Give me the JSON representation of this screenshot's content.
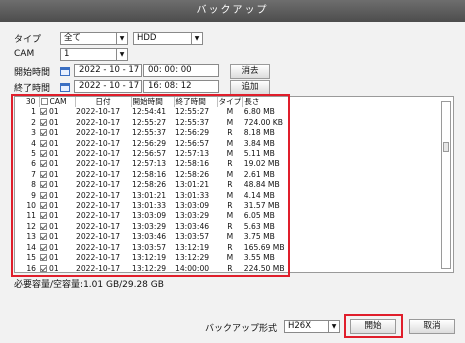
{
  "window": {
    "title": "バックアップ"
  },
  "filters": {
    "type_label": "タイプ",
    "type_value": "全て",
    "device_value": "HDD",
    "cam_label": "CAM",
    "cam_value": "1",
    "start_label": "開始時間",
    "start_date": "2022 - 10 - 17",
    "start_time": "00: 00: 00",
    "clear_button": "消去",
    "end_label": "終了時間",
    "end_date": "2022 - 10 - 17",
    "end_time": "16: 08: 12",
    "add_button": "追加"
  },
  "table": {
    "headers": {
      "count": "30",
      "cam": "CAM",
      "date": "日付",
      "start": "開始時間",
      "end": "終了時間",
      "type": "タイプ",
      "length": "長さ"
    },
    "rows": [
      {
        "no": "1",
        "cam": "01",
        "date": "2022-10-17",
        "start": "12:54:41",
        "end": "12:55:27",
        "type": "M",
        "length": "6.80 MB"
      },
      {
        "no": "2",
        "cam": "01",
        "date": "2022-10-17",
        "start": "12:55:27",
        "end": "12:55:37",
        "type": "M",
        "length": "724.00 KB"
      },
      {
        "no": "3",
        "cam": "01",
        "date": "2022-10-17",
        "start": "12:55:37",
        "end": "12:56:29",
        "type": "R",
        "length": "8.18 MB"
      },
      {
        "no": "4",
        "cam": "01",
        "date": "2022-10-17",
        "start": "12:56:29",
        "end": "12:56:57",
        "type": "M",
        "length": "3.84 MB"
      },
      {
        "no": "5",
        "cam": "01",
        "date": "2022-10-17",
        "start": "12:56:57",
        "end": "12:57:13",
        "type": "M",
        "length": "5.11 MB"
      },
      {
        "no": "6",
        "cam": "01",
        "date": "2022-10-17",
        "start": "12:57:13",
        "end": "12:58:16",
        "type": "R",
        "length": "19.02 MB"
      },
      {
        "no": "7",
        "cam": "01",
        "date": "2022-10-17",
        "start": "12:58:16",
        "end": "12:58:26",
        "type": "M",
        "length": "2.61 MB"
      },
      {
        "no": "8",
        "cam": "01",
        "date": "2022-10-17",
        "start": "12:58:26",
        "end": "13:01:21",
        "type": "R",
        "length": "48.84 MB"
      },
      {
        "no": "9",
        "cam": "01",
        "date": "2022-10-17",
        "start": "13:01:21",
        "end": "13:01:33",
        "type": "M",
        "length": "4.14 MB"
      },
      {
        "no": "10",
        "cam": "01",
        "date": "2022-10-17",
        "start": "13:01:33",
        "end": "13:03:09",
        "type": "R",
        "length": "31.57 MB"
      },
      {
        "no": "11",
        "cam": "01",
        "date": "2022-10-17",
        "start": "13:03:09",
        "end": "13:03:29",
        "type": "M",
        "length": "6.05 MB"
      },
      {
        "no": "12",
        "cam": "01",
        "date": "2022-10-17",
        "start": "13:03:29",
        "end": "13:03:46",
        "type": "R",
        "length": "5.63 MB"
      },
      {
        "no": "13",
        "cam": "01",
        "date": "2022-10-17",
        "start": "13:03:46",
        "end": "13:03:57",
        "type": "M",
        "length": "3.75 MB"
      },
      {
        "no": "14",
        "cam": "01",
        "date": "2022-10-17",
        "start": "13:03:57",
        "end": "13:12:19",
        "type": "R",
        "length": "165.69 MB"
      },
      {
        "no": "15",
        "cam": "01",
        "date": "2022-10-17",
        "start": "13:12:19",
        "end": "13:12:29",
        "type": "M",
        "length": "3.55 MB"
      },
      {
        "no": "16",
        "cam": "01",
        "date": "2022-10-17",
        "start": "13:12:29",
        "end": "14:00:00",
        "type": "R",
        "length": "224.50 MB"
      }
    ]
  },
  "footer": {
    "capacity_text": "必要容量/空容量:1.01 GB/29.28 GB",
    "format_label": "バックアップ形式",
    "format_value": "H26X",
    "start_button": "開始",
    "cancel_button": "取消"
  },
  "colors": {
    "highlight": "#e01e2b",
    "titlebar": "#5a5a5a"
  }
}
